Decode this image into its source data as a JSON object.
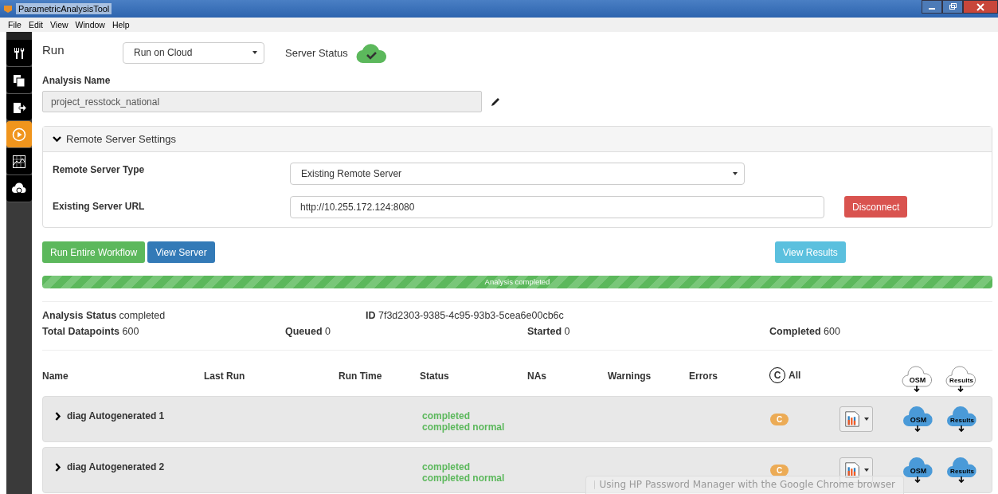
{
  "window": {
    "title": "ParametricAnalysisTool"
  },
  "menu": [
    "File",
    "Edit",
    "View",
    "Window",
    "Help"
  ],
  "sidebar": [
    {
      "kind": "tools",
      "selected": false
    },
    {
      "kind": "copy",
      "selected": false
    },
    {
      "kind": "export",
      "selected": false
    },
    {
      "kind": "run",
      "selected": true
    },
    {
      "kind": "chart",
      "selected": false
    },
    {
      "kind": "cloud",
      "selected": false
    }
  ],
  "run": {
    "label": "Run",
    "mode": "Run on Cloud",
    "server_status_label": "Server Status",
    "server_ok": true
  },
  "analysis_name": {
    "label": "Analysis Name",
    "value": "project_resstock_national"
  },
  "remote_settings": {
    "title": "Remote Server Settings",
    "expanded": true,
    "server_type_label": "Remote Server Type",
    "server_type": "Existing Remote Server",
    "url_label": "Existing Server URL",
    "url": "http://10.255.172.124:8080",
    "disconnect": "Disconnect"
  },
  "actions": {
    "run": "Run Entire Workflow",
    "view_server": "View Server",
    "view_results": "View Results"
  },
  "progress": {
    "level": 1,
    "label": "Analysis completed"
  },
  "summary": {
    "status_label": "Analysis Status",
    "status": "completed",
    "id_label": "ID",
    "id": "7f3d2303-9385-4c95-93b3-5cea6e00cb6c",
    "stats": [
      {
        "label": "Total Datapoints",
        "value": "600"
      },
      {
        "label": "Queued",
        "value": "0"
      },
      {
        "label": "Started",
        "value": "0"
      },
      {
        "label": "Completed",
        "value": "600"
      }
    ]
  },
  "table": {
    "columns": [
      "Name",
      "Last Run",
      "Run Time",
      "Status",
      "NAs",
      "Warnings",
      "Errors"
    ],
    "all_badge": "C",
    "all_label": "All",
    "osm_label": "OSM",
    "results_label": "Results",
    "rows": [
      {
        "name": "diag Autogenerated 1",
        "status": "completed",
        "status_detail": "completed normal",
        "badge": "C",
        "expanded": false,
        "osm_label": "OSM",
        "results_label": "Results"
      },
      {
        "name": "diag Autogenerated 2",
        "status": "completed",
        "status_detail": "completed normal",
        "badge": "C",
        "expanded": false,
        "osm_label": "OSM",
        "results_label": "Results"
      }
    ]
  },
  "notification": {
    "text": "Using HP Password Manager with the Google Chrome browser"
  }
}
